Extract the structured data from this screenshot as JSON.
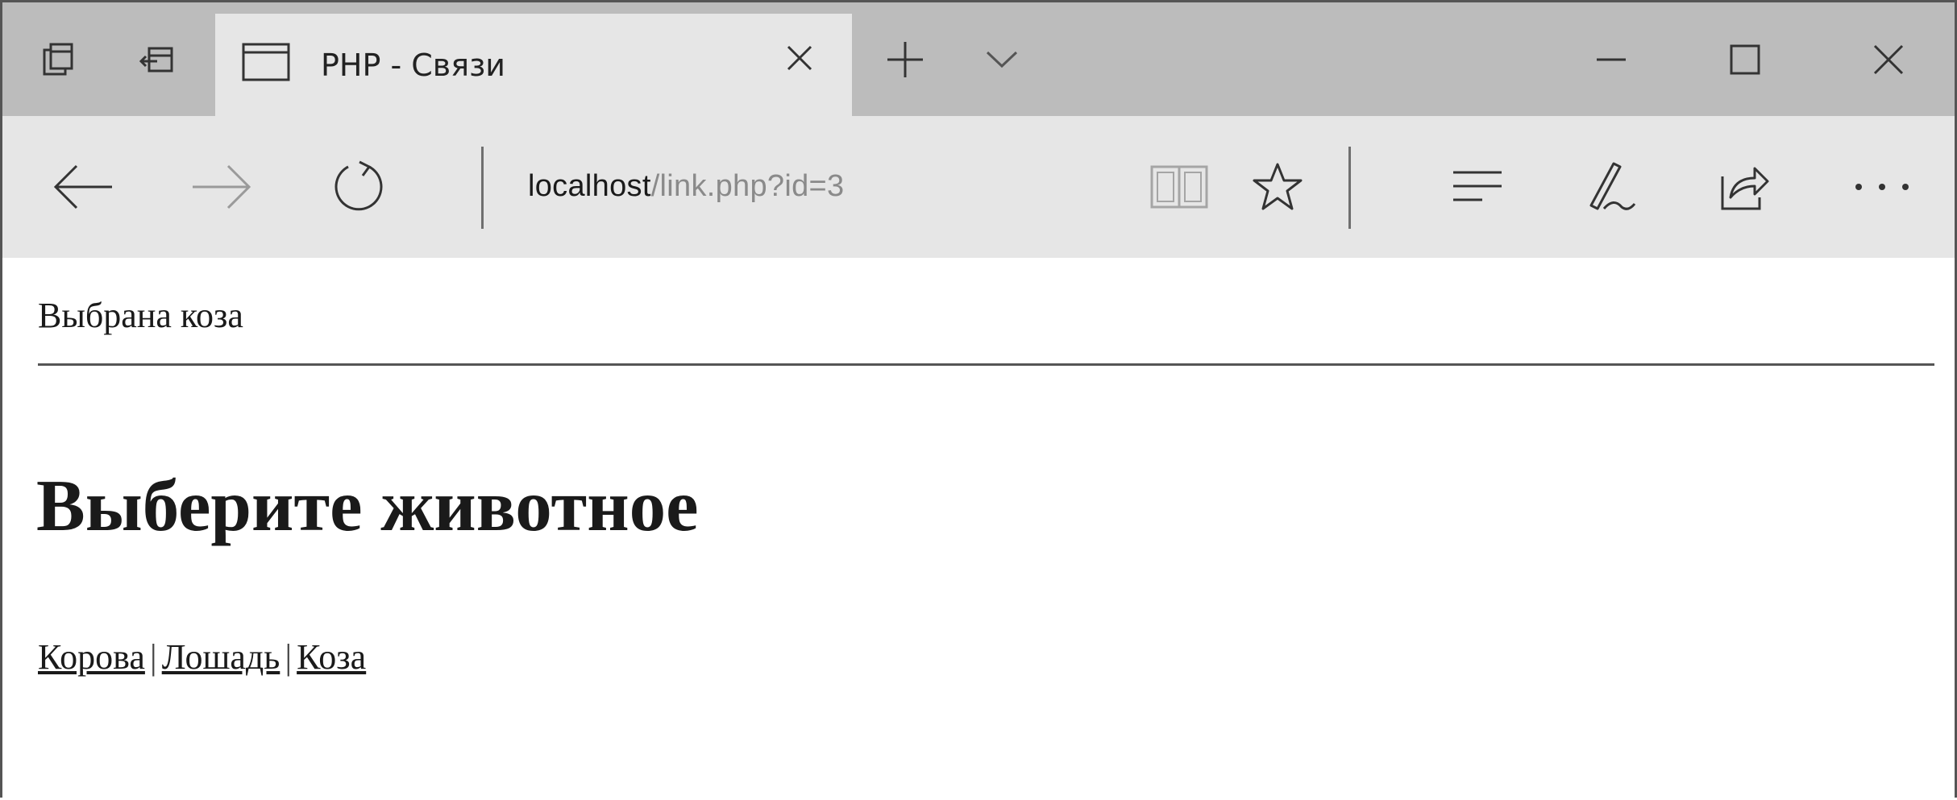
{
  "tab": {
    "title": "PHP - Связи"
  },
  "address": {
    "host": "localhost",
    "path": "/link.php?id=3"
  },
  "page": {
    "selected_text": "Выбрана коза",
    "heading": "Выберите животное",
    "links": [
      {
        "label": "Корова"
      },
      {
        "label": "Лошадь"
      },
      {
        "label": "Коза"
      }
    ],
    "separator": "|"
  },
  "icons": {
    "tab_manager": "tab-manager-icon",
    "set_aside": "set-tabs-aside-icon",
    "tab_page": "page-icon",
    "close_tab": "close-icon",
    "new_tab": "plus-icon",
    "tab_preview": "chevron-down-icon",
    "minimize": "minimize-icon",
    "maximize": "maximize-icon",
    "close_window": "close-icon",
    "back": "arrow-left-icon",
    "forward": "arrow-right-icon",
    "refresh": "refresh-icon",
    "reading_view": "book-icon",
    "favorite": "star-icon",
    "hub": "hub-icon",
    "notes": "pen-icon",
    "share": "share-icon",
    "more": "ellipsis-icon"
  }
}
